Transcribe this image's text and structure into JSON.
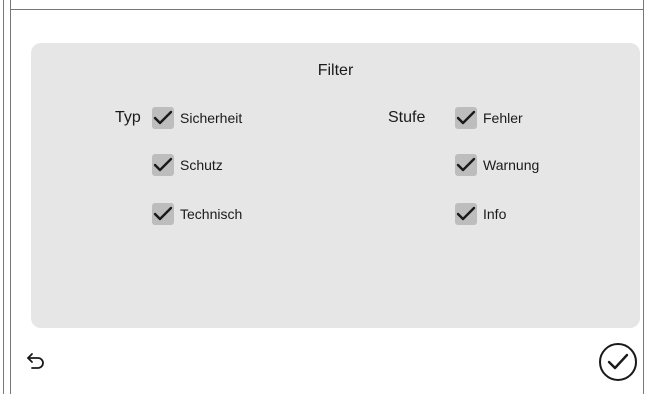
{
  "filter": {
    "title": "Filter",
    "typ": {
      "label": "Typ",
      "options": [
        {
          "label": "Sicherheit",
          "checked": true
        },
        {
          "label": "Schutz",
          "checked": true
        },
        {
          "label": "Technisch",
          "checked": true
        }
      ]
    },
    "stufe": {
      "label": "Stufe",
      "options": [
        {
          "label": "Fehler",
          "checked": true
        },
        {
          "label": "Warnung",
          "checked": true
        },
        {
          "label": "Info",
          "checked": true
        }
      ]
    }
  },
  "footer": {
    "back_icon": "undo-arrow-icon",
    "confirm_icon": "checkmark-circle-icon"
  },
  "colors": {
    "panel": "#e6e6e6",
    "checkbox": "#bdbdbd",
    "frame": "#777777"
  }
}
